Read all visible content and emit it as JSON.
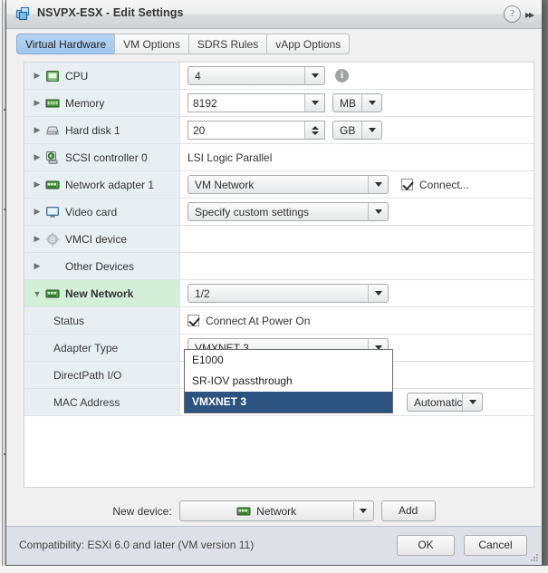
{
  "window": {
    "title": "NSVPX-ESX - Edit Settings",
    "icon": "vm-icon",
    "help_icon": "?",
    "expand_icon": "▸▸"
  },
  "tabs": [
    {
      "label": "Virtual Hardware",
      "active": true
    },
    {
      "label": "VM Options",
      "active": false
    },
    {
      "label": "SDRS Rules",
      "active": false
    },
    {
      "label": "vApp Options",
      "active": false
    }
  ],
  "devices": [
    {
      "label": "CPU",
      "icon": "cpu-icon",
      "value": "4",
      "control": "combo"
    },
    {
      "label": "Memory",
      "icon": "memory-icon",
      "value": "8192",
      "unit": "MB",
      "control": "textbox-combo"
    },
    {
      "label": "Hard disk 1",
      "icon": "harddisk-icon",
      "value": "20",
      "unit": "GB",
      "control": "textbox-spinner"
    },
    {
      "label": "SCSI controller 0",
      "icon": "scsi-icon",
      "value": "LSI Logic Parallel",
      "control": "text"
    },
    {
      "label": "Network adapter 1",
      "icon": "network-icon",
      "value": "VM Network",
      "control": "combo",
      "checkbox_label": "Connect...",
      "checked": true
    },
    {
      "label": "Video card",
      "icon": "videocard-icon",
      "value": "Specify custom settings",
      "control": "combo"
    },
    {
      "label": "VMCI device",
      "icon": "vmci-icon",
      "value": "",
      "control": "none"
    },
    {
      "label": "Other Devices",
      "icon": "",
      "value": "",
      "control": "none"
    }
  ],
  "new_network": {
    "label": "New Network",
    "icon": "network-icon",
    "value": "1/2",
    "expanded": true,
    "sub_rows": [
      {
        "label": "Status",
        "control": "checkbox",
        "checkbox_label": "Connect At Power On",
        "checked": true
      },
      {
        "label": "Adapter Type",
        "control": "combo",
        "value": "VMXNET 3"
      },
      {
        "label": "DirectPath I/O",
        "control": "none",
        "value": ""
      },
      {
        "label": "MAC Address",
        "control": "combo",
        "value": "Automatic"
      }
    ]
  },
  "dropdown": {
    "open": true,
    "options": [
      "E1000",
      "SR-IOV passthrough",
      "VMXNET 3"
    ],
    "selected": "VMXNET 3"
  },
  "new_device": {
    "label": "New device:",
    "selected": "Network",
    "icon": "network-icon",
    "add_button": "Add"
  },
  "footer": {
    "compatibility": "Compatibility: ESXi 6.0 and later (VM version 11)",
    "ok_label": "OK",
    "cancel_label": "Cancel"
  },
  "colors": {
    "accent_tab": "#a2c6ee",
    "selected_row": "#d4efd8",
    "label_column": "#e8eff3",
    "dropdown_selected": "#2d5480"
  }
}
